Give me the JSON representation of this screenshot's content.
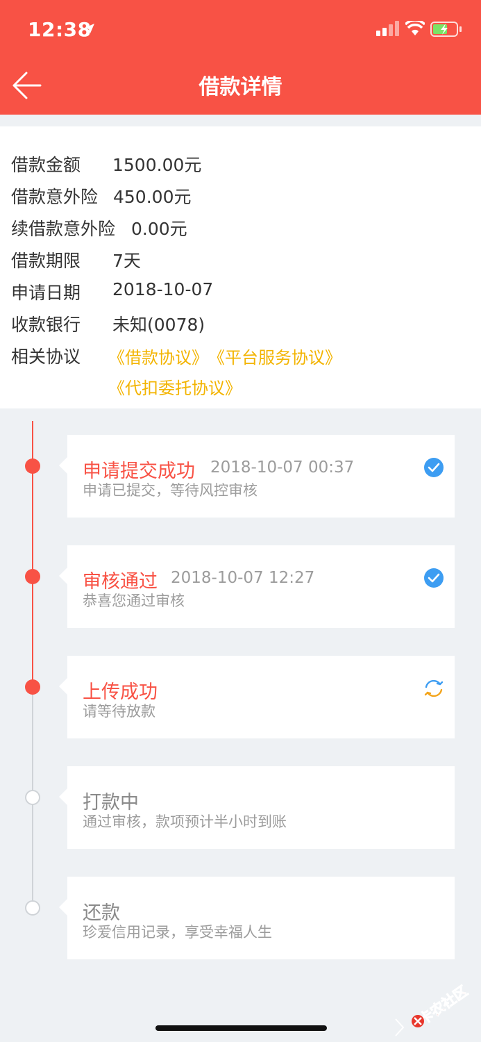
{
  "status_bar": {
    "time": "12:38"
  },
  "header": {
    "title": "借款详情"
  },
  "loan_info": {
    "rows": [
      {
        "label": "借款金额",
        "value": "1500.00元"
      },
      {
        "label": "借款意外险",
        "value": "450.00元"
      },
      {
        "label": "续借款意外险",
        "value": "0.00元"
      },
      {
        "label": "借款期限",
        "value": "7天"
      },
      {
        "label": "申请日期",
        "value": "2018-10-07"
      },
      {
        "label": "收款银行",
        "value": "未知(0078)"
      }
    ],
    "agreements_label": "相关协议",
    "agreements": [
      "《借款协议》",
      "《平台服务协议》",
      "《代扣委托协议》"
    ]
  },
  "timeline": {
    "steps": [
      {
        "title": "申请提交成功",
        "time": "2018-10-07 00:37",
        "desc": "申请已提交，等待风控审核",
        "status": "done"
      },
      {
        "title": "审核通过",
        "time": "2018-10-07 12:27",
        "desc": "恭喜您通过审核",
        "status": "done"
      },
      {
        "title": "上传成功",
        "time": "",
        "desc": "请等待放款",
        "status": "processing"
      },
      {
        "title": "打款中",
        "time": "",
        "desc": "通过审核，款项预计半小时到账",
        "status": "pending"
      },
      {
        "title": "还款",
        "time": "",
        "desc": "珍爱信用记录，享受幸福人生",
        "status": "pending"
      }
    ]
  },
  "watermark": {
    "text": "卡农社区"
  },
  "colors": {
    "primary": "#f85245",
    "agreement": "#f3b400",
    "check": "#3d9df2",
    "refresh": "#f3a41b"
  }
}
